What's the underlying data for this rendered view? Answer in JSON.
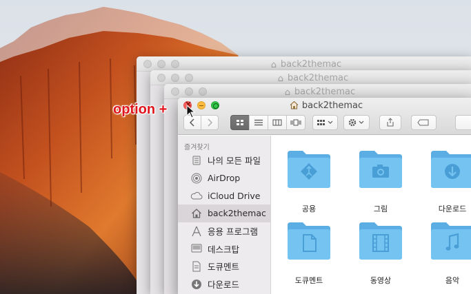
{
  "window_title": "back2themac",
  "ghost_windows": [
    {
      "title": "back2themac"
    },
    {
      "title": "back2themac"
    },
    {
      "title": "back2themac"
    }
  ],
  "callout": {
    "text": "option +",
    "color": "#e0141d"
  },
  "toolbar": {
    "back": "back-icon",
    "forward": "forward-icon",
    "views": [
      "icon-view",
      "list-view",
      "column-view",
      "coverflow-view"
    ],
    "active_view": "icon-view",
    "arrange": "arrange-icon",
    "action": "gear-icon",
    "share": "share-icon",
    "tags": "tag-icon"
  },
  "sidebar": {
    "header": "즐겨찾기",
    "items": [
      {
        "label": "나의 모든 파일",
        "icon": "all-files-icon"
      },
      {
        "label": "AirDrop",
        "icon": "airdrop-icon"
      },
      {
        "label": "iCloud Drive",
        "icon": "cloud-icon"
      },
      {
        "label": "back2themac",
        "icon": "home-icon",
        "selected": true
      },
      {
        "label": "응용 프로그램",
        "icon": "applications-icon"
      },
      {
        "label": "데스크탑",
        "icon": "desktop-icon"
      },
      {
        "label": "도큐멘트",
        "icon": "documents-icon"
      },
      {
        "label": "다운로드",
        "icon": "downloads-icon"
      }
    ]
  },
  "folders": [
    {
      "label": "공용",
      "icon": "public-folder-icon"
    },
    {
      "label": "그림",
      "icon": "pictures-folder-icon"
    },
    {
      "label": "다운로드",
      "icon": "downloads-folder-icon"
    },
    {
      "label": "도큐멘트",
      "icon": "documents-folder-icon"
    },
    {
      "label": "동영상",
      "icon": "movies-folder-icon"
    },
    {
      "label": "음악",
      "icon": "music-folder-icon"
    }
  ],
  "colors": {
    "folder": "#74c3f1",
    "folder_dark": "#5aaee4",
    "selection": "#d9d5d9"
  }
}
